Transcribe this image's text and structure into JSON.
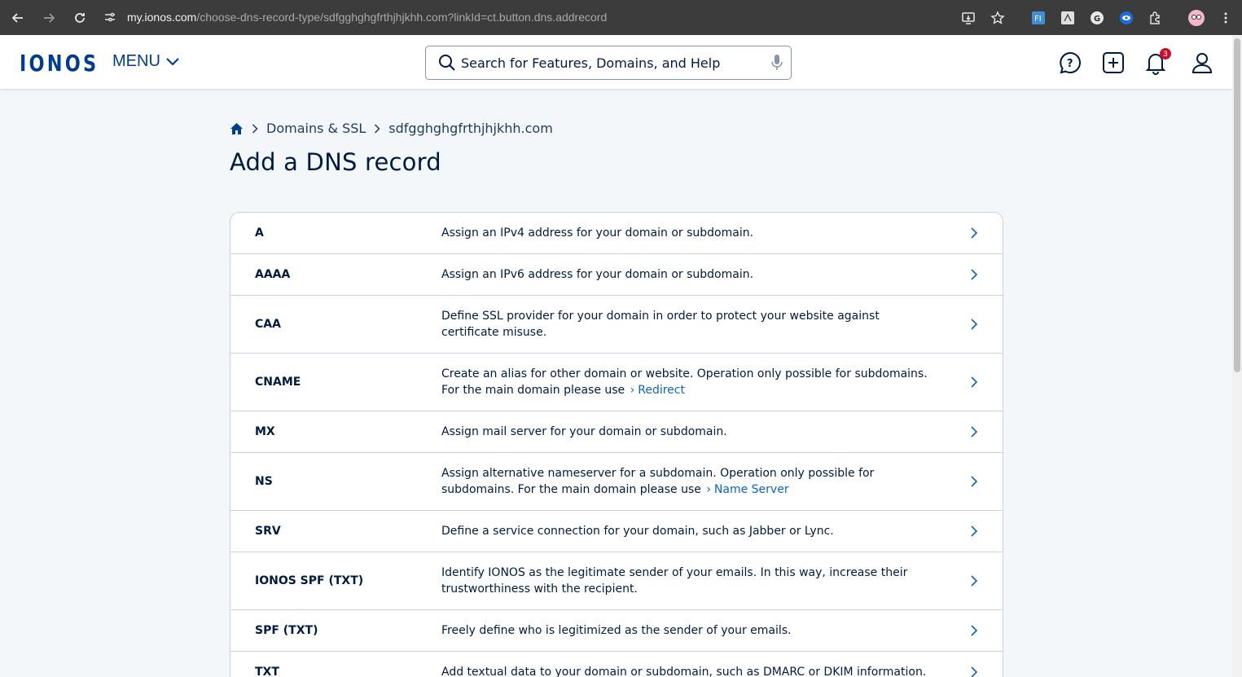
{
  "browser": {
    "url_host": "my.ionos.com",
    "url_path": "/choose-dns-record-type/sdfgghghgfrthjhjkhh.com?linkId=ct.button.dns.addrecord",
    "icons": [
      "back-icon",
      "forward-icon",
      "reload-icon",
      "site-info-icon",
      "install-app-icon",
      "bookmark-star-icon",
      "extension-icon",
      "puzzle-icon",
      "profile-avatar",
      "kebab-menu-icon"
    ]
  },
  "header": {
    "logo": "IONOS",
    "menu_label": "MENU",
    "search_placeholder": "Search for Features, Domains, and Help",
    "notifications_count": "3"
  },
  "breadcrumb": {
    "items": [
      "Domains & SSL",
      "sdfgghghgfrthjhjkhh.com"
    ]
  },
  "page_title": "Add a DNS record",
  "records": [
    {
      "type": "A",
      "description": "Assign an IPv4 address for your domain or subdomain."
    },
    {
      "type": "AAAA",
      "description": "Assign an IPv6 address for your domain or subdomain."
    },
    {
      "type": "CAA",
      "description": "Define SSL provider for your domain in order to protect your website against certificate misuse."
    },
    {
      "type": "CNAME",
      "description": "Create an alias for other domain or website. Operation only possible for subdomains. For the main domain please use",
      "link": "Redirect"
    },
    {
      "type": "MX",
      "description": "Assign mail server for your domain or subdomain."
    },
    {
      "type": "NS",
      "description": "Assign alternative nameserver for a subdomain. Operation only possible for subdomains. For the main domain please use",
      "link": "Name Server"
    },
    {
      "type": "SRV",
      "description": "Define a service connection for your domain, such as Jabber or Lync."
    },
    {
      "type": "IONOS SPF (TXT)",
      "description": "Identify IONOS as the legitimate sender of your emails. In this way, increase their trustworthiness with the recipient."
    },
    {
      "type": "SPF (TXT)",
      "description": "Freely define who is legitimized as the sender of your emails."
    },
    {
      "type": "TXT",
      "description": "Add textual data to your domain or subdomain, such as DMARC or DKIM information."
    }
  ],
  "colors": {
    "brand": "#003d8f",
    "text": "#001b41",
    "link": "#0b62cc",
    "page_bg": "#f4f7fa",
    "badge": "#c8102e"
  }
}
